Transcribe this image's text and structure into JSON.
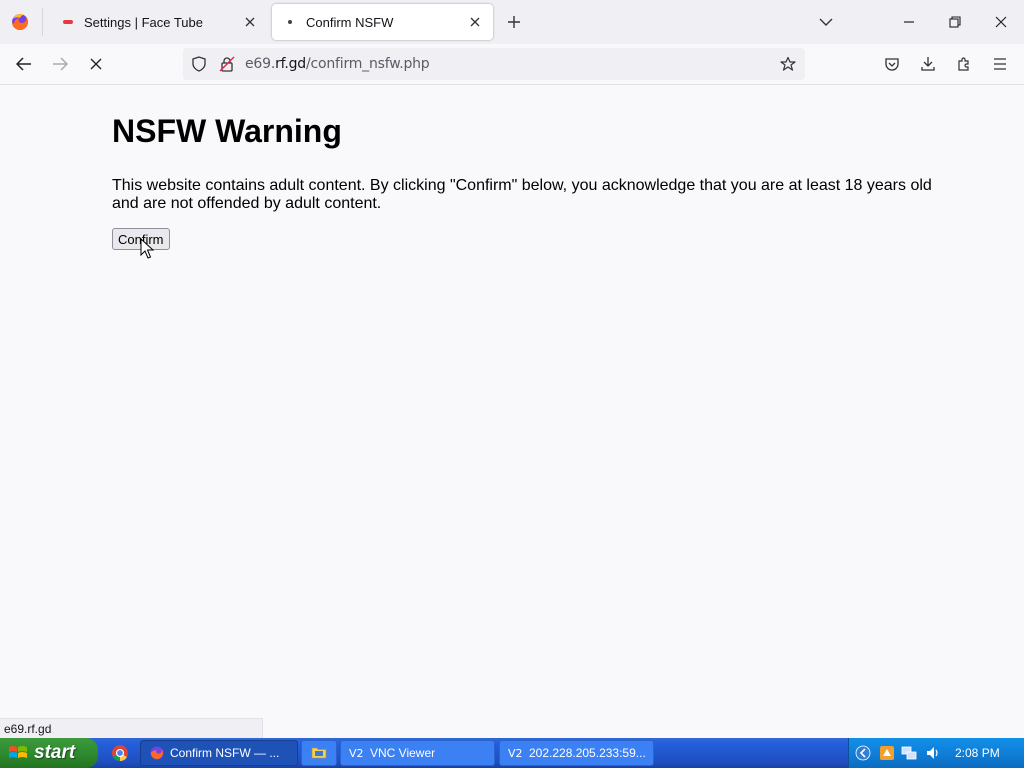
{
  "browser": {
    "tabs": [
      {
        "title": "Settings | Face Tube",
        "active": false
      },
      {
        "title": "Confirm NSFW",
        "active": true
      }
    ],
    "url": {
      "host_dim": "e69.",
      "host_main": "rf.gd",
      "path": "/confirm_nsfw.php"
    },
    "status_text": "e69.rf.gd"
  },
  "page": {
    "title": "NSFW Warning",
    "message": "This website contains adult content. By clicking \"Confirm\" below, you acknowledge that you are at least 18 years old and are not offended by adult content.",
    "confirm_label": "Confirm"
  },
  "taskbar": {
    "start_label": "start",
    "tasks": [
      {
        "label": "Confirm NSFW — ...",
        "icon": "firefox-icon",
        "active": true
      },
      {
        "label": "",
        "icon": "folder-icon",
        "active": false
      },
      {
        "label": "VNC Viewer",
        "icon": "vnc-icon",
        "active": false
      },
      {
        "label": "202.228.205.233:59...",
        "icon": "vnc-icon",
        "active": false
      }
    ],
    "clock": "2:08 PM"
  },
  "colors": {
    "taskbar": "#245edb",
    "start": "#2f8b2f",
    "tray": "#0f7fd8"
  }
}
